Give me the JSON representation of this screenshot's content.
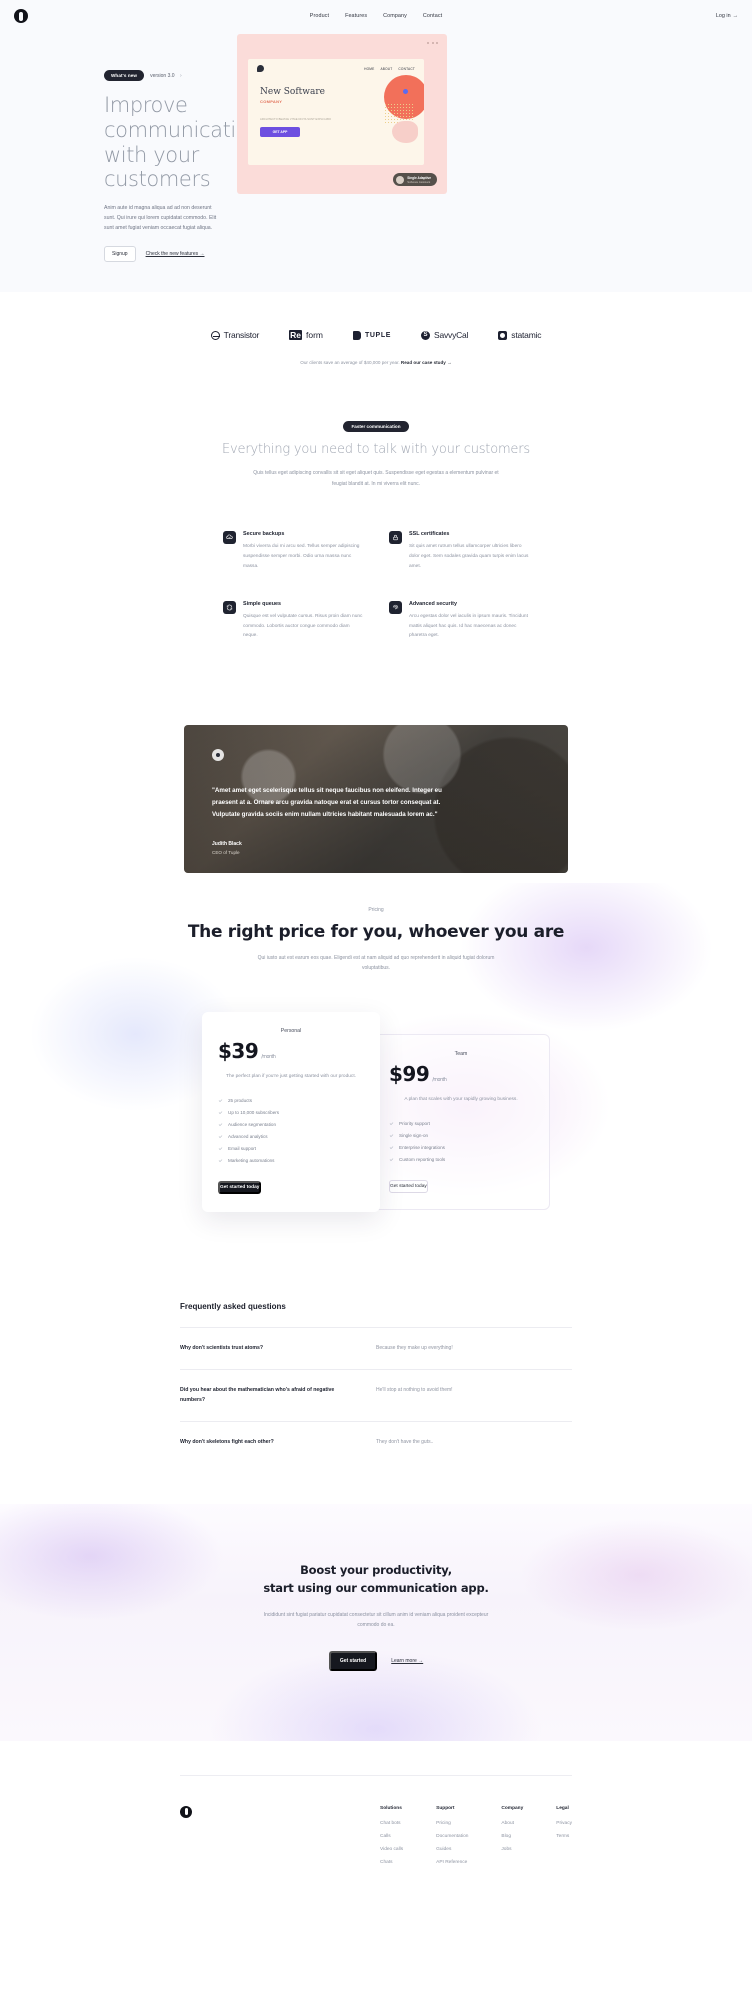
{
  "nav": {
    "logo_icon": "company-mark-icon",
    "links": [
      "Product",
      "Features",
      "Company",
      "Contact"
    ],
    "login": "Log in",
    "login_arrow": "→"
  },
  "hero": {
    "badge": "What's new",
    "version": "version 3.0",
    "version_chevron": "›",
    "title": "Improve communication with your customers",
    "body": "Anim aute id magna aliqua ad ad non deserunt sunt. Qui irure qui lorem cupidatat commodo. Elit sunt amet fugiat veniam occaecat fugiat aliqua.",
    "primary_button": "Signup",
    "secondary_link": "Check the new features →",
    "art": {
      "nav_links": [
        "HOME",
        "ABOUT",
        "CONTACT"
      ],
      "headline": "New Software",
      "subhead": "COMPANY",
      "micro": "ARCHITECTO BEATAE VITAE DICTA SUNT EXPLICABO",
      "button": "GET APP",
      "chip_title": "Single Adaptive",
      "chip_sub": "Software Assistant",
      "dots": "•••"
    }
  },
  "logos": {
    "items": [
      {
        "name": "Transistor",
        "icon": "transistor-logo-icon"
      },
      {
        "name": "Reform",
        "icon": "reform-logo-icon"
      },
      {
        "name": "TUPLE",
        "icon": "tuple-logo-icon"
      },
      {
        "name": "SavvyCal",
        "icon": "savvycal-logo-icon"
      },
      {
        "name": "statamic",
        "icon": "statamic-logo-icon"
      }
    ],
    "note_prefix": "Our clients save an average of $40,000 per year. ",
    "note_link": "Read our case study →"
  },
  "features": {
    "badge": "Faster communication",
    "title": "Everything you need to talk with your customers",
    "subtitle": "Quis tellus eget adipiscing convallis sit sit eget aliquet quis. Suspendisse eget egestas a elementum pulvinar et feugiat blandit at. In mi viverra elit nunc.",
    "items": [
      {
        "icon": "cloud-backup-icon",
        "title": "Secure backups",
        "text": "Morbi viverra dui mi arcu sed. Tellus semper adipiscing suspendisse semper morbi. Odio urna massa nunc massa."
      },
      {
        "icon": "lock-icon",
        "title": "SSL certificates",
        "text": "Sit quis amet rutrum tellus ullamcorper ultricies libero dolor eget. Sem sodales gravida quam turpis enim lacus amet."
      },
      {
        "icon": "refresh-queue-icon",
        "title": "Simple queues",
        "text": "Quisque est vel vulputate cursus. Risus proin diam nunc commodo. Lobortis auctor congue commodo diam neque."
      },
      {
        "icon": "fingerprint-icon",
        "title": "Advanced security",
        "text": "Arcu egestas dolor vel iaculis in ipsum mauris. Tincidunt mattis aliquet hac quis. Id hac maecenas ac donec pharetra eget."
      }
    ]
  },
  "testimonial": {
    "mark_icon": "quote-mark-icon",
    "quote": "\"Amet amet eget scelerisque tellus sit neque faucibus non eleifend. Integer eu praesent at a. Ornare arcu gravida natoque erat et cursus tortor consequat at. Vulputate gravida sociis enim nullam ultricies habitant malesuada lorem ac.\"",
    "name": "Judith Black",
    "role": "CEO of Tuple"
  },
  "pricing": {
    "eyebrow": "Pricing",
    "title": "The right price for you, whoever you are",
    "subtitle": "Qui iusto aut est earum eos quae. Eligendi est at nam aliquid ad quo reprehenderit in aliquid fugiat dolorum voluptatibus.",
    "plans": [
      {
        "name": "Personal",
        "price": "$39",
        "per": "/month",
        "desc": "The perfect plan if you're just getting started with our product.",
        "features": [
          "25 products",
          "Up to 10,000 subscribers",
          "Audience segmentation",
          "Advanced analytics",
          "Email support",
          "Marketing automations"
        ],
        "button": "Get started today",
        "featured": true
      },
      {
        "name": "Team",
        "price": "$99",
        "per": "/month",
        "desc": "A plan that scales with your rapidly growing business.",
        "features": [
          "Priority support",
          "Single sign-on",
          "Enterprise integrations",
          "Custom reporting tools"
        ],
        "button": "Get started today",
        "featured": false
      }
    ]
  },
  "faq": {
    "title": "Frequently asked questions",
    "items": [
      {
        "q": "Why don't scientists trust atoms?",
        "a": "Because they make up everything!"
      },
      {
        "q": "Did you hear about the mathematician who's afraid of negative numbers?",
        "a": "He'll stop at nothing to avoid them!"
      },
      {
        "q": "Why don't skeletons fight each other?",
        "a": "They don't have the guts.."
      }
    ]
  },
  "cta": {
    "title_line1": "Boost your productivity,",
    "title_line2": "start using our communication app.",
    "body": "Incididunt sint fugiat pariatur cupidatat consectetur sit cillum anim id veniam aliqua proident excepteur commodo do ea.",
    "primary_button": "Get started",
    "secondary_link": "Learn more →"
  },
  "footer": {
    "logo_icon": "company-mark-icon",
    "columns": [
      {
        "heading": "Solutions",
        "links": [
          "Chat bots",
          "Calls",
          "Video calls",
          "Chats"
        ]
      },
      {
        "heading": "Support",
        "links": [
          "Pricing",
          "Documentation",
          "Guides",
          "API Reference"
        ]
      },
      {
        "heading": "Company",
        "links": [
          "About",
          "Blog",
          "Jobs"
        ]
      },
      {
        "heading": "Legal",
        "links": [
          "Privacy",
          "Terms"
        ]
      }
    ]
  }
}
